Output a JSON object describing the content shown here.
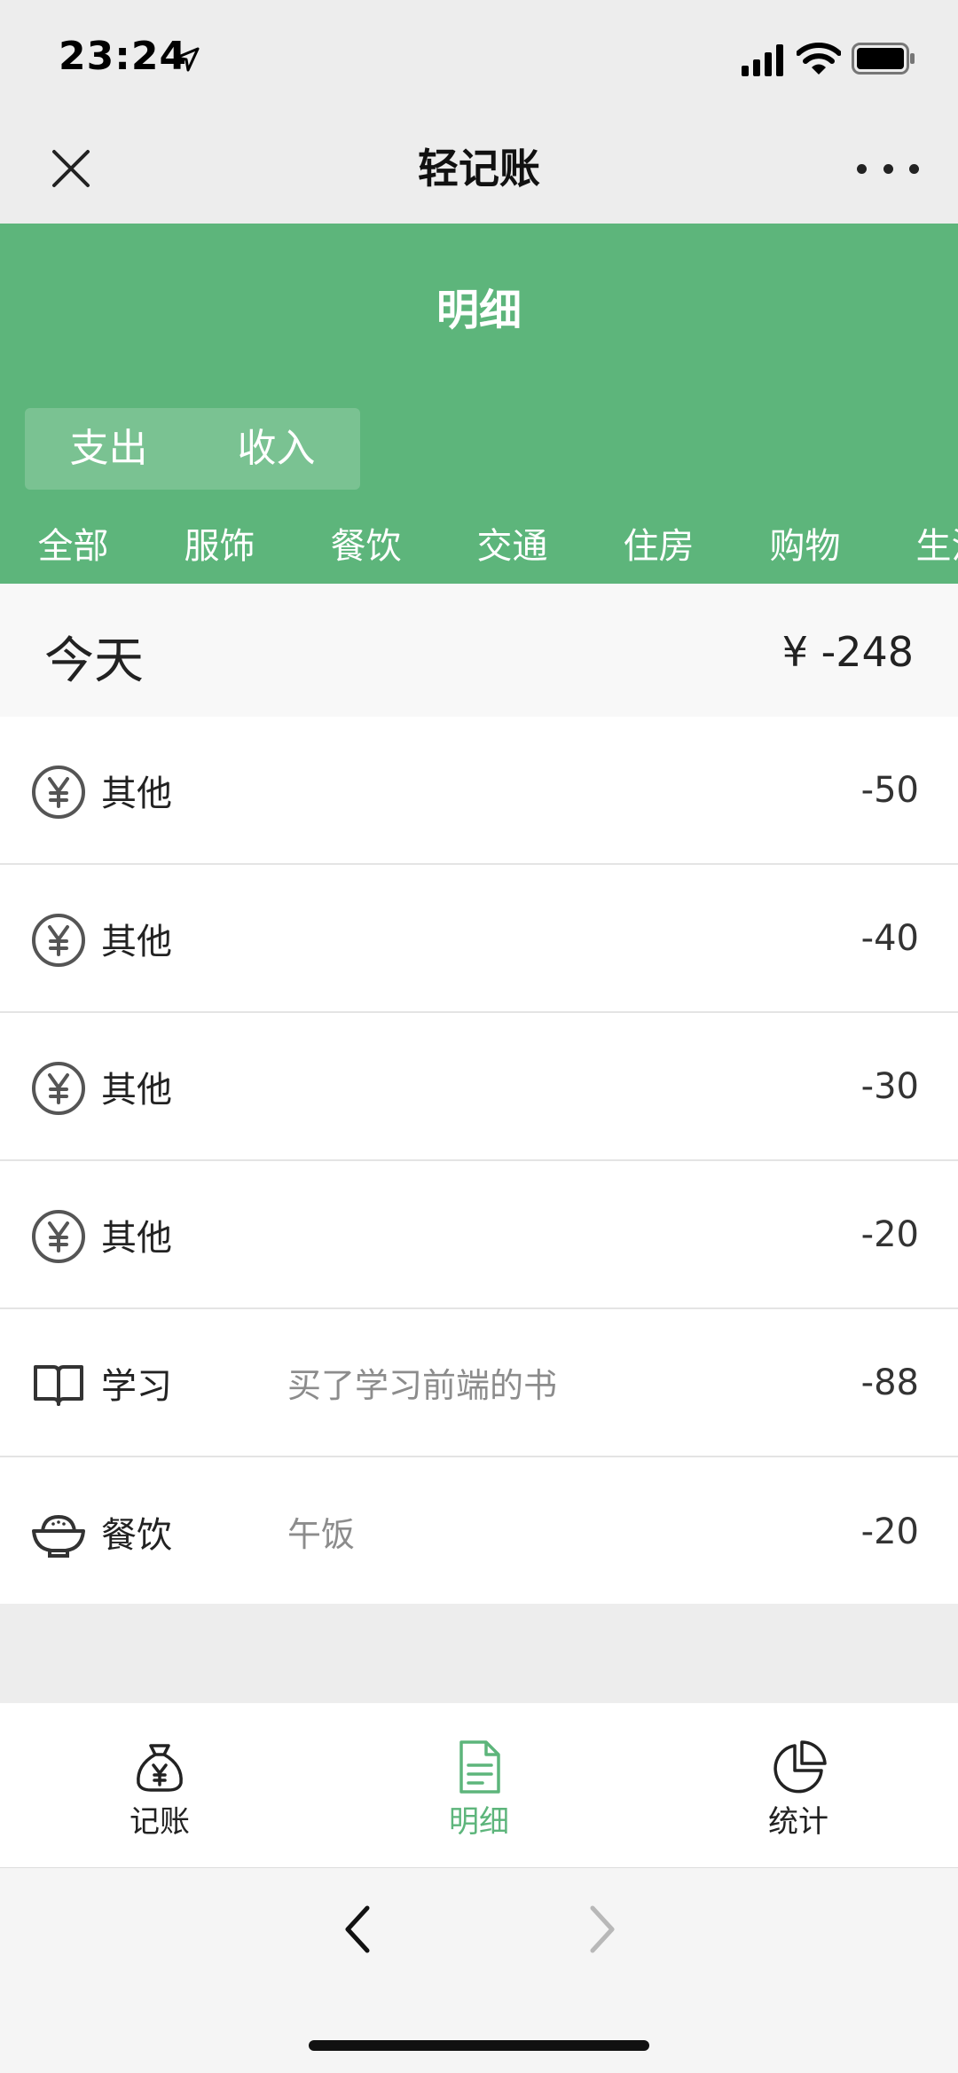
{
  "status": {
    "time": "23:24"
  },
  "nav": {
    "title": "轻记账"
  },
  "header": {
    "title": "明细",
    "types": [
      "支出",
      "收入"
    ],
    "categories": [
      "全部",
      "服饰",
      "餐饮",
      "交通",
      "住房",
      "购物",
      "生活"
    ]
  },
  "day": {
    "label": "今天",
    "total": "¥  -248"
  },
  "records": [
    {
      "category": "其他",
      "note": "",
      "amount": "-50",
      "icon": "yen-circle-icon"
    },
    {
      "category": "其他",
      "note": "",
      "amount": "-40",
      "icon": "yen-circle-icon"
    },
    {
      "category": "其他",
      "note": "",
      "amount": "-30",
      "icon": "yen-circle-icon"
    },
    {
      "category": "其他",
      "note": "",
      "amount": "-20",
      "icon": "yen-circle-icon"
    },
    {
      "category": "学习",
      "note": "买了学习前端的书",
      "amount": "-88",
      "icon": "book-icon"
    },
    {
      "category": "餐饮",
      "note": "午饭",
      "amount": "-20",
      "icon": "rice-bowl-icon"
    }
  ],
  "tabbar": {
    "items": [
      {
        "label": "记账",
        "icon": "money-bag-icon"
      },
      {
        "label": "明细",
        "icon": "document-icon"
      },
      {
        "label": "统计",
        "icon": "pie-chart-icon"
      }
    ],
    "active_color": "#5db57b"
  },
  "theme": {
    "primary": "#5db57b"
  }
}
